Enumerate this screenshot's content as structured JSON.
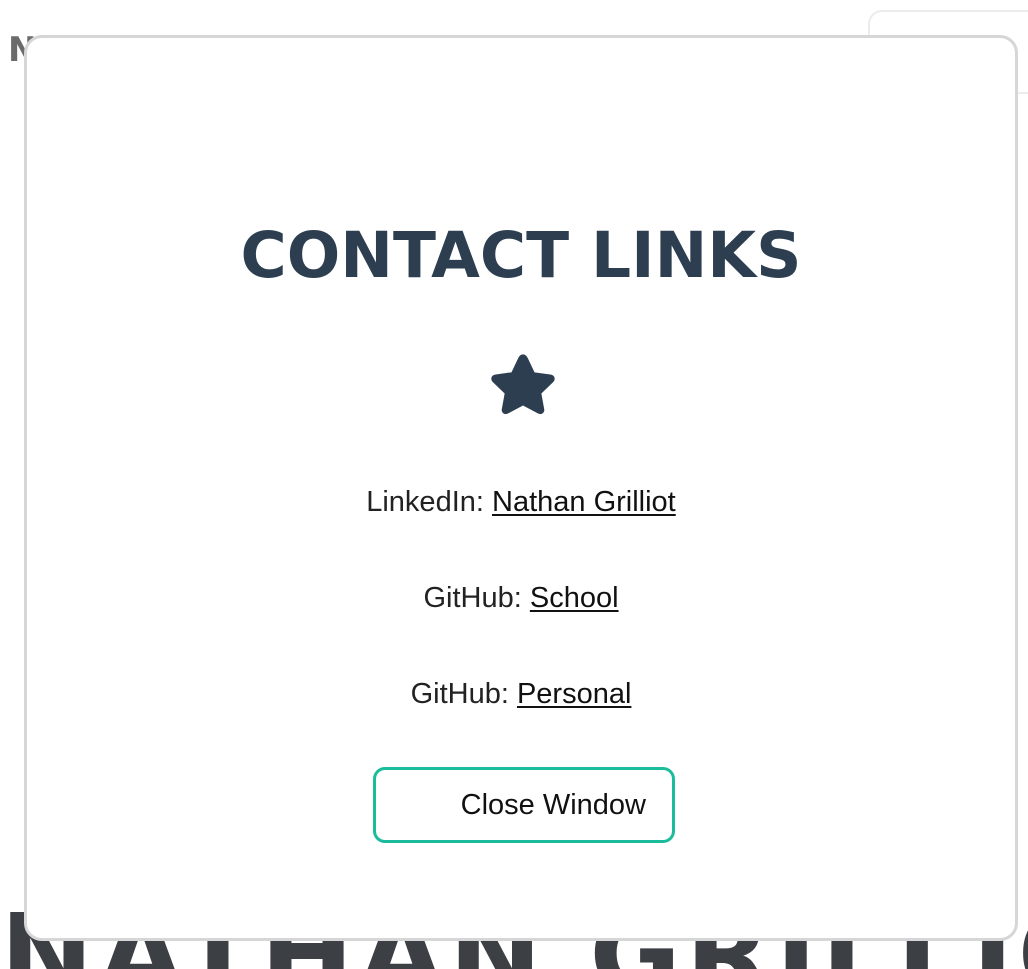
{
  "background": {
    "nav_letter": "N",
    "hero_name": "NATHAN GRILLIOT"
  },
  "modal": {
    "title": "CONTACT LINKS",
    "icon": "star-icon",
    "icon_color": "#2c3e50",
    "links": [
      {
        "label": "LinkedIn:",
        "link_text": "Nathan Grilliot"
      },
      {
        "label": "GitHub:",
        "link_text": "School"
      },
      {
        "label": "GitHub:",
        "link_text": "Personal"
      }
    ],
    "close_label": "Close Window",
    "accent_color": "#1abc9c"
  }
}
